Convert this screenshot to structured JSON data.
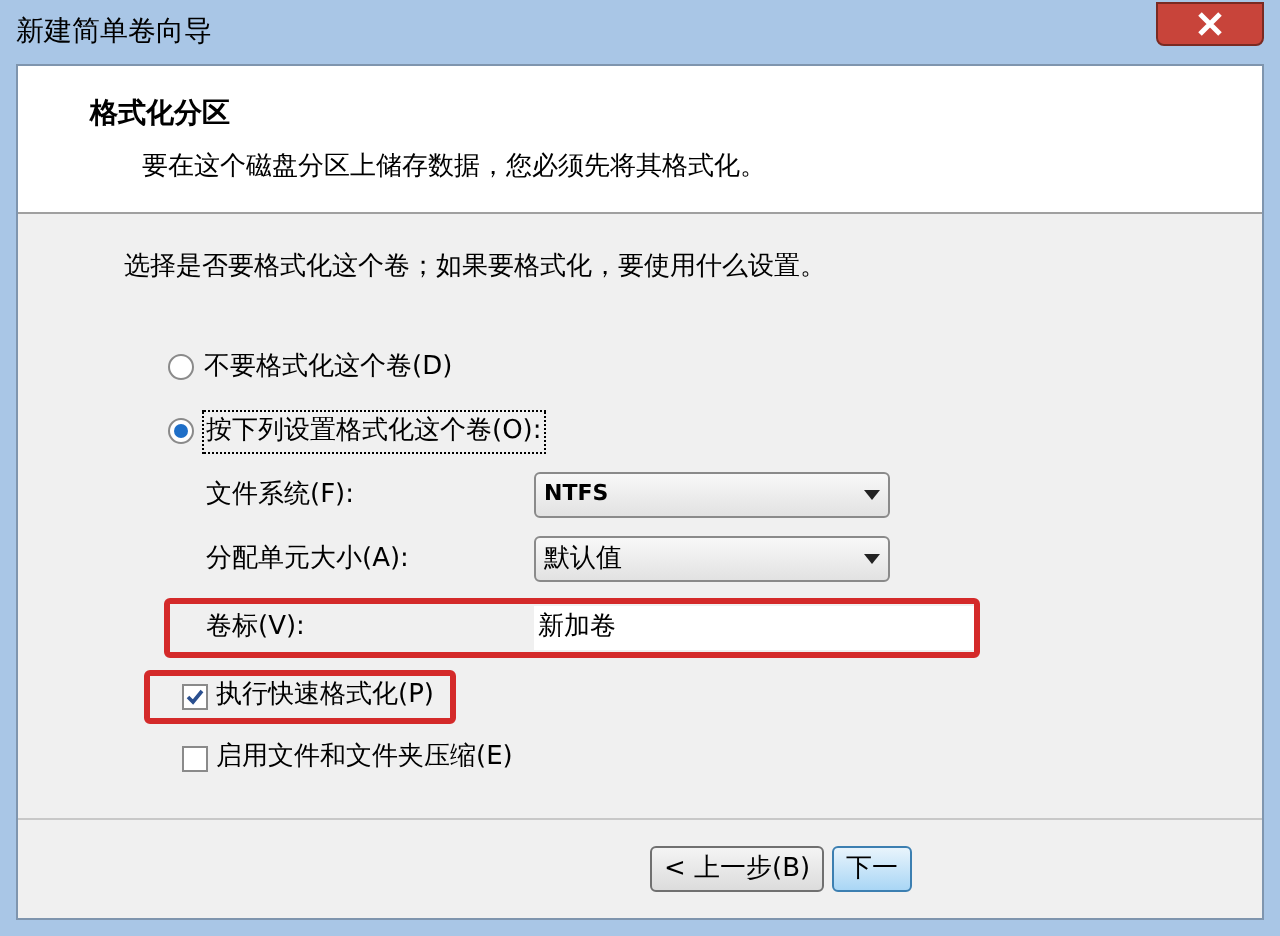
{
  "window": {
    "title": "新建简单卷向导"
  },
  "header": {
    "title": "格式化分区",
    "subtitle": "要在这个磁盘分区上储存数据，您必须先将其格式化。"
  },
  "instruction": "选择是否要格式化这个卷；如果要格式化，要使用什么设置。",
  "format_options": [
    {
      "label": "不要格式化这个卷(D)",
      "selected": false
    },
    {
      "label": "按下列设置格式化这个卷(O):",
      "selected": true
    }
  ],
  "settings": [
    {
      "kind": "dropdown",
      "label": "文件系统(F):",
      "value": "NTFS",
      "highlighted": false
    },
    {
      "kind": "dropdown",
      "label": "分配单元大小(A):",
      "value": "默认值",
      "highlighted": false
    },
    {
      "kind": "text",
      "label": "卷标(V):",
      "value": "新加卷",
      "highlighted": true
    }
  ],
  "checkboxes": [
    {
      "label": "执行快速格式化(P)",
      "checked": true,
      "highlighted": true
    },
    {
      "label": "启用文件和文件夹压缩(E)",
      "checked": false,
      "highlighted": false
    }
  ],
  "buttons": [
    {
      "label": "< 上一步(B)",
      "primary": false
    },
    {
      "label": "下一",
      "primary": true
    }
  ]
}
